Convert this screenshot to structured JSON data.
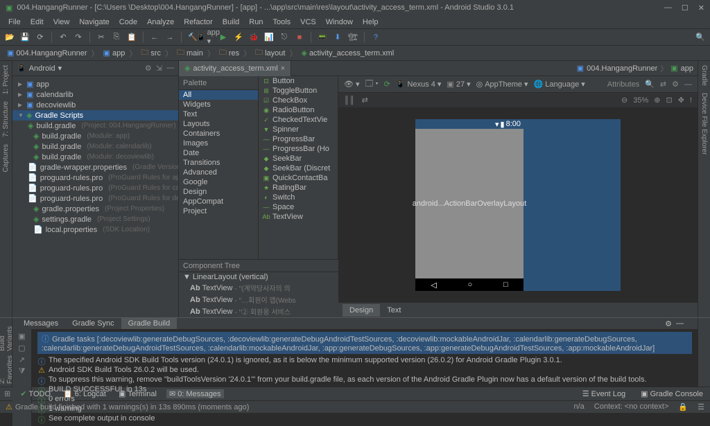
{
  "window": {
    "title": "004.HangangRunner - [C:\\Users      \\Desktop\\004.HangangRunner] - [app] - ...\\app\\src\\main\\res\\layout\\activity_access_term.xml - Android Studio 3.0.1"
  },
  "menu": [
    "File",
    "Edit",
    "View",
    "Navigate",
    "Code",
    "Analyze",
    "Refactor",
    "Build",
    "Run",
    "Tools",
    "VCS",
    "Window",
    "Help"
  ],
  "breadcrumbs": [
    {
      "icon": "module",
      "label": "004.HangangRunner"
    },
    {
      "icon": "module",
      "label": "app"
    },
    {
      "icon": "folder",
      "label": "src"
    },
    {
      "icon": "folder",
      "label": "main"
    },
    {
      "icon": "folder",
      "label": "res"
    },
    {
      "icon": "folder",
      "label": "layout"
    },
    {
      "icon": "xml",
      "label": "activity_access_term.xml"
    }
  ],
  "left_tabs": [
    "1: Project",
    "7: Structure",
    "Captures"
  ],
  "right_tabs": [
    "Gradle",
    "Device File Explorer"
  ],
  "project": {
    "view": "Android",
    "tree": [
      {
        "d": 0,
        "arrow": "▶",
        "ic": "module",
        "label": "app"
      },
      {
        "d": 0,
        "arrow": "▶",
        "ic": "module",
        "label": "calendarlib"
      },
      {
        "d": 0,
        "arrow": "▶",
        "ic": "module",
        "label": "decoviewlib"
      },
      {
        "d": 0,
        "arrow": "▼",
        "ic": "gradle",
        "label": "Gradle Scripts",
        "sel": true
      },
      {
        "d": 1,
        "ic": "gradle",
        "label": "build.gradle",
        "hint": "(Project: 004.HangangRunner)"
      },
      {
        "d": 1,
        "ic": "gradle",
        "label": "build.gradle",
        "hint": "(Module: app)"
      },
      {
        "d": 1,
        "ic": "gradle",
        "label": "build.gradle",
        "hint": "(Module: calendarlib)"
      },
      {
        "d": 1,
        "ic": "gradle",
        "label": "build.gradle",
        "hint": "(Module: decoviewlib)"
      },
      {
        "d": 1,
        "ic": "file",
        "label": "gradle-wrapper.properties",
        "hint": "(Gradle Version)"
      },
      {
        "d": 1,
        "ic": "file",
        "label": "proguard-rules.pro",
        "hint": "(ProGuard Rules for app)"
      },
      {
        "d": 1,
        "ic": "file",
        "label": "proguard-rules.pro",
        "hint": "(ProGuard Rules for calendarlib)"
      },
      {
        "d": 1,
        "ic": "file",
        "label": "proguard-rules.pro",
        "hint": "(ProGuard Rules for decoviewlib)"
      },
      {
        "d": 1,
        "ic": "gradle",
        "label": "gradle.properties",
        "hint": "(Project Properties)"
      },
      {
        "d": 1,
        "ic": "gradle",
        "label": "settings.gradle",
        "hint": "(Project Settings)"
      },
      {
        "d": 1,
        "ic": "file",
        "label": "local.properties",
        "hint": "(SDK Location)"
      }
    ]
  },
  "editor_tabs": [
    {
      "icon": "xml",
      "label": "activity_access_term.xml",
      "close": "×"
    }
  ],
  "editor_right_crumbs": [
    {
      "ic": "module",
      "label": "004.HangangRunner"
    },
    {
      "ic": "app",
      "label": "app"
    }
  ],
  "palette": {
    "header": "Palette",
    "categories": [
      "All",
      "Widgets",
      "Text",
      "Layouts",
      "Containers",
      "Images",
      "Date",
      "Transitions",
      "Advanced",
      "Google",
      "Design",
      "AppCompat",
      "Project"
    ],
    "selected": "All",
    "widgets": [
      {
        "ic": "⊡",
        "label": "Button"
      },
      {
        "ic": "⊞",
        "label": "ToggleButton"
      },
      {
        "ic": "☑",
        "label": "CheckBox"
      },
      {
        "ic": "◉",
        "label": "RadioButton"
      },
      {
        "ic": "✓",
        "label": "CheckedTextVie"
      },
      {
        "ic": "▼",
        "label": "Spinner"
      },
      {
        "ic": "—",
        "label": "ProgressBar"
      },
      {
        "ic": "—",
        "label": "ProgressBar (Ho"
      },
      {
        "ic": "◆",
        "label": "SeekBar"
      },
      {
        "ic": "◆",
        "label": "SeekBar (Discret"
      },
      {
        "ic": "▣",
        "label": "QuickContactBa"
      },
      {
        "ic": "★",
        "label": "RatingBar"
      },
      {
        "ic": "◐",
        "label": "Switch"
      },
      {
        "ic": "—",
        "label": "Space"
      },
      {
        "ic": "Ab",
        "label": "TextView"
      }
    ]
  },
  "design_toolbar": {
    "device": "Nexus 4",
    "api": "27",
    "theme": "AppTheme",
    "lang": "Language",
    "zoom": "35%"
  },
  "phone": {
    "time": "8:00",
    "content": "android...ActionBarOverlayLayout"
  },
  "attributes": {
    "header": "Attributes"
  },
  "component_tree": {
    "header": "Component Tree",
    "items": [
      {
        "d": 0,
        "arrow": "▼",
        "label": "LinearLayout (vertical)"
      },
      {
        "d": 1,
        "ic": "Ab",
        "label": "TextView",
        "hint": "- \"(계약당사자의 의"
      },
      {
        "d": 1,
        "ic": "Ab",
        "label": "TextView",
        "hint": "- \"…회원이 앱(Webs"
      },
      {
        "d": 1,
        "ic": "Ab",
        "label": "TextView",
        "hint": "- \"② 회원용 서비스"
      }
    ]
  },
  "design_tabs": [
    "Design",
    "Text"
  ],
  "bottom_tabs": [
    "Messages",
    "Gradle Sync",
    "Gradle Build"
  ],
  "messages": {
    "task_line": "Gradle tasks [:decoviewlib:generateDebugSources, :decoviewlib:generateDebugAndroidTestSources, :decoviewlib:mockableAndroidJar, :calendarlib:generateDebugSources, :calendarlib:generateDebugAndroidTestSources, :calendarlib:mockableAndroidJar, :app:generateDebugSources, :app:generateDebugAndroidTestSources, :app:mockableAndroidJar]",
    "lines": [
      {
        "type": "info",
        "text": "The specified Android SDK Build Tools version (24.0.1) is ignored, as it is below the minimum supported version (26.0.2) for Android Gradle Plugin 3.0.1."
      },
      {
        "type": "warn",
        "text": "Android SDK Build Tools 26.0.2 will be used."
      },
      {
        "type": "info",
        "text": "To suppress this warning, remove \"buildToolsVersion '24.0.1'\" from your build.gradle file, as each version of the Android Gradle Plugin now has a default version of the build tools."
      },
      {
        "type": "info2",
        "text": "BUILD SUCCESSFUL in 13s"
      },
      {
        "type": "info2",
        "text": "0 errors"
      },
      {
        "type": "info2",
        "text": "1 warning"
      },
      {
        "type": "info2",
        "text": "See complete output in console"
      }
    ]
  },
  "bottom_left_tabs": [
    "Build Variants",
    "2: Favorites"
  ],
  "bottom_toolbar": {
    "items": [
      {
        "ic": "✔",
        "label": "TODO"
      },
      {
        "ic": "📋",
        "label": "6: Logcat"
      },
      {
        "ic": "▣",
        "label": "Terminal"
      },
      {
        "ic": "✉",
        "label": "0: Messages",
        "sel": true
      }
    ],
    "right": [
      "Event Log",
      "Gradle Console"
    ]
  },
  "status": {
    "text": "Gradle build finished with 1 warnings(s) in 13s 890ms (moments ago)",
    "right": [
      "n/a",
      "Context: <no context>"
    ]
  }
}
